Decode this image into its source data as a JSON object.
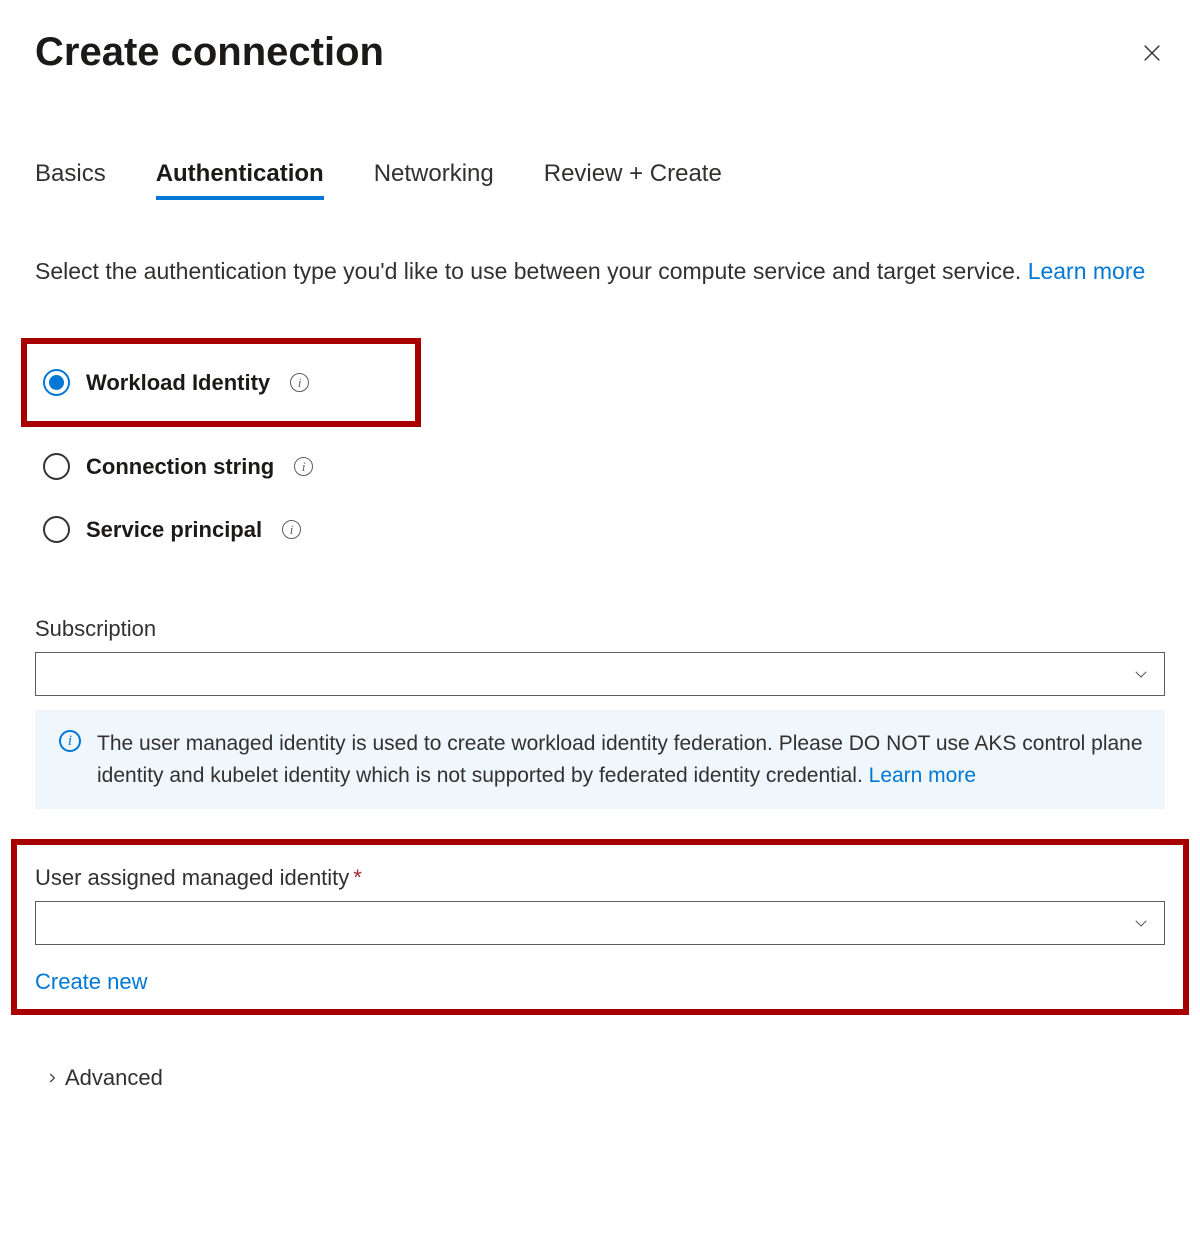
{
  "header": {
    "title": "Create connection"
  },
  "tabs": [
    {
      "label": "Basics",
      "active": false
    },
    {
      "label": "Authentication",
      "active": true
    },
    {
      "label": "Networking",
      "active": false
    },
    {
      "label": "Review + Create",
      "active": false
    }
  ],
  "description": {
    "text": "Select the authentication type you'd like to use between your compute service and target service. ",
    "link": "Learn more"
  },
  "auth_options": [
    {
      "label": "Workload Identity",
      "selected": true,
      "highlighted": true
    },
    {
      "label": "Connection string",
      "selected": false,
      "highlighted": false
    },
    {
      "label": "Service principal",
      "selected": false,
      "highlighted": false
    }
  ],
  "subscription": {
    "label": "Subscription",
    "value": ""
  },
  "info_box": {
    "text": "The user managed identity is used to create workload identity federation. Please DO NOT use AKS control plane identity and kubelet identity which is not supported by federated identity credential. ",
    "link": "Learn more"
  },
  "user_identity": {
    "label": "User assigned managed identity",
    "required_marker": "*",
    "value": "",
    "create_new": "Create new"
  },
  "advanced": {
    "label": "Advanced"
  }
}
